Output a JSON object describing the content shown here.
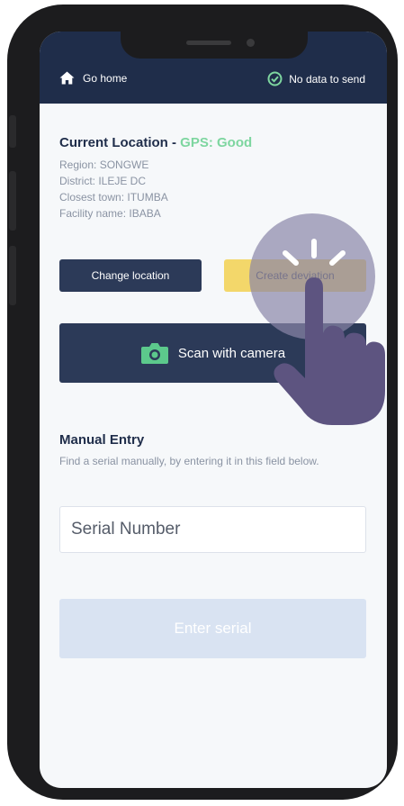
{
  "header": {
    "home_label": "Go home",
    "sync_status": "No data to send",
    "colors": {
      "bar": "#1f2d4a",
      "status_ok": "#7ed6a0"
    }
  },
  "location": {
    "title": "Current Location -",
    "gps_status": "GPS: Good",
    "region": "Region: SONGWE",
    "district": "District: ILEJE DC",
    "closest_town": "Closest town: ITUMBA",
    "facility": "Facility name: IBABA"
  },
  "actions": {
    "change_location": "Change location",
    "create_deviation": "Create deviation",
    "scan_camera": "Scan with camera"
  },
  "manual": {
    "title": "Manual Entry",
    "description": "Find a serial manually, by entering it in this field below.",
    "serial_placeholder": "Serial Number",
    "enter_button": "Enter serial"
  },
  "icons": {
    "home": "home-icon",
    "status": "check-circle-icon",
    "scan": "camera-icon",
    "gesture": "tap-hand-icon"
  }
}
